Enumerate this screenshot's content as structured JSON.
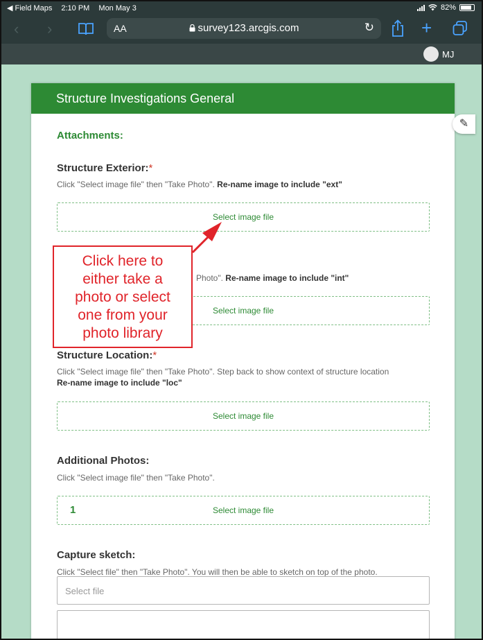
{
  "status_bar": {
    "back_app": "◀ Field Maps",
    "time": "2:10 PM",
    "date": "Mon May 3",
    "battery": "82%"
  },
  "browser": {
    "text_size": "AA",
    "url": "survey123.arcgis.com",
    "accent_color": "#4aa3ff"
  },
  "user": {
    "initials": "MJ"
  },
  "form": {
    "title": "Structure Investigations General",
    "section": "Attachments:",
    "accent_color": "#2d8a34",
    "questions": {
      "exterior": {
        "title": "Structure Exterior:",
        "required": "*",
        "hint_plain": "Click \"Select image file\" then \"Take Photo\". ",
        "hint_bold": "Re-name image to include \"ext\"",
        "button": "Select image file"
      },
      "interior": {
        "hint_plain": "Photo\". ",
        "hint_bold": "Re-name image to include \"int\"",
        "button": "Select image file"
      },
      "location": {
        "title": "Structure Location:",
        "required": "*",
        "hint_plain": "Click \"Select image file\" then \"Take Photo\". Step back to show context of structure location",
        "hint_bold": "Re-name image to include \"loc\"",
        "button": "Select image file"
      },
      "additional": {
        "title": "Additional Photos:",
        "hint": "Click \"Select image file\" then \"Take Photo\".",
        "count": "1",
        "button": "Select image file"
      },
      "sketch": {
        "title": "Capture sketch:",
        "hint": "Click \"Select file\" then \"Take Photo\". You will then be able to sketch on top of the photo.",
        "placeholder": "Select file"
      }
    }
  },
  "annotation": {
    "lines": [
      "Click here to",
      "either take a",
      "photo or select",
      "one from your",
      "photo library"
    ],
    "color": "#e0242a"
  }
}
